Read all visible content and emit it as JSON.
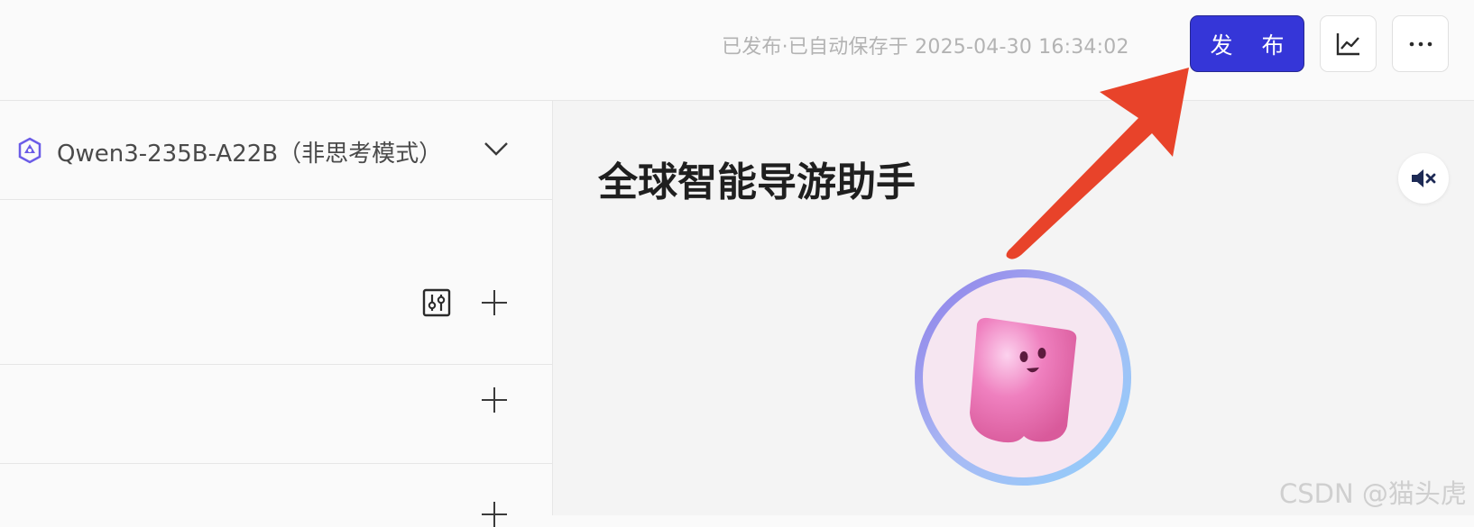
{
  "header": {
    "save_status": "已发布·已自动保存于 2025-04-30 16:34:02",
    "publish_label": "发 布",
    "analytics_icon": "line-chart-icon",
    "more_icon": "ellipsis-icon"
  },
  "config": {
    "model_icon": "qwen-logo-icon",
    "model_name": "Qwen3-235B-A22B（非思考模式）",
    "model_dropdown_icon": "chevron-down-icon",
    "sections": [
      {
        "actions": [
          "settings-sliders-icon",
          "plus-icon"
        ]
      },
      {
        "actions": [
          "plus-icon"
        ]
      },
      {
        "actions": [
          "plus-icon"
        ]
      }
    ]
  },
  "preview": {
    "title": "全球智能导游助手",
    "mute_icon": "volume-mute-icon",
    "avatar": "pink-blob-avatar"
  },
  "annotation": {
    "arrow_color": "#e8432a",
    "target": "publish-button"
  },
  "watermark": "CSDN @猫头虎",
  "colors": {
    "accent": "#3536d8",
    "arrow": "#e8432a",
    "qwen_logo": "#6b5ce7"
  }
}
